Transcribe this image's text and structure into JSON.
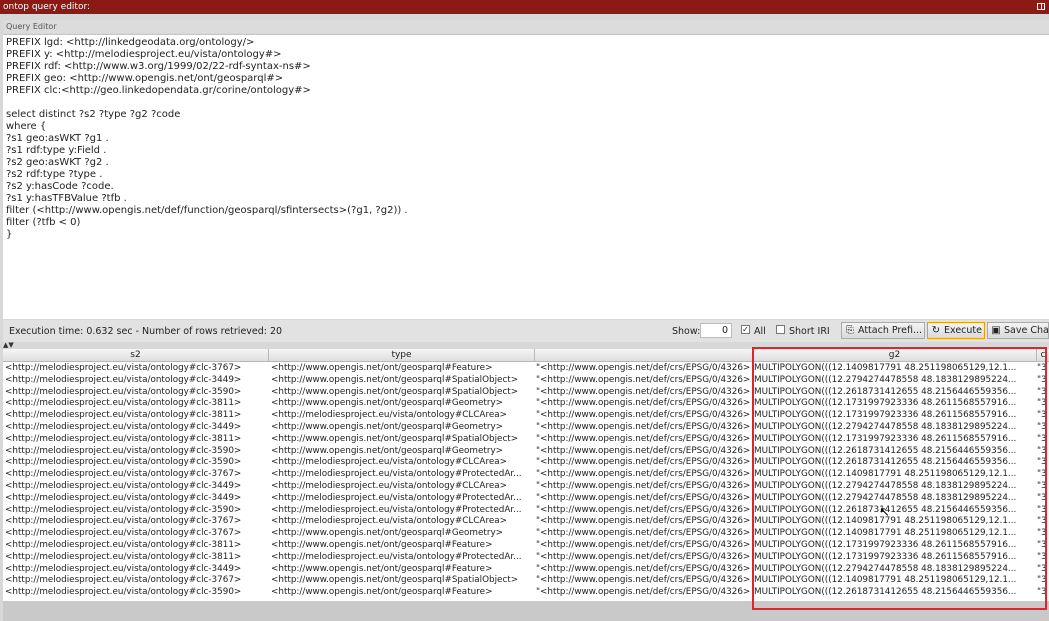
{
  "window": {
    "title": "ontop query editor:"
  },
  "panel": {
    "title": "Query Editor"
  },
  "editor": {
    "lines": [
      "PREFIX lgd: <http://linkedgeodata.org/ontology/>",
      "PREFIX y: <http://melodiesproject.eu/vista/ontology#>",
      "PREFIX rdf: <http://www.w3.org/1999/02/22-rdf-syntax-ns#>",
      "PREFIX geo: <http://www.opengis.net/ont/geosparql#>",
      "PREFIX clc:<http://geo.linkedopendata.gr/corine/ontology#>",
      "",
      "select distinct ?s2 ?type ?g2 ?code",
      "where {",
      "?s1 geo:asWKT ?g1 .",
      "?s1 rdf:type y:Field .",
      "?s2 geo:asWKT ?g2 .",
      "?s2 rdf:type ?type .",
      "?s2 y:hasCode ?code.",
      "?s1 y:hasTFBValue ?tfb .",
      "filter (<http://www.opengis.net/def/function/geosparql/sfintersects>(?g1, ?g2)) .",
      "filter (?tfb < 0)",
      "}"
    ]
  },
  "toolbar": {
    "execution_text": "Execution time: 0.632 sec - Number of rows retrieved: 20",
    "show_label": "Show:",
    "show_value": "0",
    "all_label": "All",
    "all_checked": true,
    "short_iri_label": "Short IRI",
    "short_iri_checked": false,
    "attach_prefix_label": "Attach Prefi...",
    "execute_label": "Execute",
    "save_label": "Save Cha"
  },
  "sort_indicator": "▲▼",
  "table": {
    "columns": [
      "s2",
      "type",
      "",
      "g2",
      "c"
    ],
    "rows": [
      [
        "<http://melodiesproject.eu/vista/ontology#clc-3767>",
        "<http://www.opengis.net/ont/geosparql#Feature>",
        "\"<http://www.opengis.net/def/crs/EPSG/0/4326>",
        "MULTIPOLYGON(((12.1409817791 48.251198065129,12.1...",
        "\"3"
      ],
      [
        "<http://melodiesproject.eu/vista/ontology#clc-3449>",
        "<http://www.opengis.net/ont/geosparql#SpatialObject>",
        "\"<http://www.opengis.net/def/crs/EPSG/0/4326>",
        "MULTIPOLYGON(((12.2794274478558 48.1838129895224...",
        "\"3"
      ],
      [
        "<http://melodiesproject.eu/vista/ontology#clc-3590>",
        "<http://www.opengis.net/ont/geosparql#SpatialObject>",
        "\"<http://www.opengis.net/def/crs/EPSG/0/4326>",
        "MULTIPOLYGON(((12.2618731412655 48.2156446559356...",
        "\"3"
      ],
      [
        "<http://melodiesproject.eu/vista/ontology#clc-3811>",
        "<http://www.opengis.net/ont/geosparql#Geometry>",
        "\"<http://www.opengis.net/def/crs/EPSG/0/4326>",
        "MULTIPOLYGON(((12.1731997923336 48.2611568557916...",
        "\"3"
      ],
      [
        "<http://melodiesproject.eu/vista/ontology#clc-3811>",
        "<http://melodiesproject.eu/vista/ontology#CLCArea>",
        "\"<http://www.opengis.net/def/crs/EPSG/0/4326>",
        "MULTIPOLYGON(((12.1731997923336 48.2611568557916...",
        "\"3"
      ],
      [
        "<http://melodiesproject.eu/vista/ontology#clc-3449>",
        "<http://www.opengis.net/ont/geosparql#Geometry>",
        "\"<http://www.opengis.net/def/crs/EPSG/0/4326>",
        "MULTIPOLYGON(((12.2794274478558 48.1838129895224...",
        "\"3"
      ],
      [
        "<http://melodiesproject.eu/vista/ontology#clc-3811>",
        "<http://www.opengis.net/ont/geosparql#SpatialObject>",
        "\"<http://www.opengis.net/def/crs/EPSG/0/4326>",
        "MULTIPOLYGON(((12.1731997923336 48.2611568557916...",
        "\"3"
      ],
      [
        "<http://melodiesproject.eu/vista/ontology#clc-3590>",
        "<http://www.opengis.net/ont/geosparql#Geometry>",
        "\"<http://www.opengis.net/def/crs/EPSG/0/4326>",
        "MULTIPOLYGON(((12.2618731412655 48.2156446559356...",
        "\"3"
      ],
      [
        "<http://melodiesproject.eu/vista/ontology#clc-3590>",
        "<http://melodiesproject.eu/vista/ontology#CLCArea>",
        "\"<http://www.opengis.net/def/crs/EPSG/0/4326>",
        "MULTIPOLYGON(((12.2618731412655 48.2156446559356...",
        "\"3"
      ],
      [
        "<http://melodiesproject.eu/vista/ontology#clc-3767>",
        "<http://melodiesproject.eu/vista/ontology#ProtectedAr...",
        "\"<http://www.opengis.net/def/crs/EPSG/0/4326>",
        "MULTIPOLYGON(((12.1409817791 48.251198065129,12.1...",
        "\"3"
      ],
      [
        "<http://melodiesproject.eu/vista/ontology#clc-3449>",
        "<http://melodiesproject.eu/vista/ontology#CLCArea>",
        "\"<http://www.opengis.net/def/crs/EPSG/0/4326>",
        "MULTIPOLYGON(((12.2794274478558 48.1838129895224...",
        "\"3"
      ],
      [
        "<http://melodiesproject.eu/vista/ontology#clc-3449>",
        "<http://melodiesproject.eu/vista/ontology#ProtectedAr...",
        "\"<http://www.opengis.net/def/crs/EPSG/0/4326>",
        "MULTIPOLYGON(((12.2794274478558 48.1838129895224...",
        "\"3"
      ],
      [
        "<http://melodiesproject.eu/vista/ontology#clc-3590>",
        "<http://melodiesproject.eu/vista/ontology#ProtectedAr...",
        "\"<http://www.opengis.net/def/crs/EPSG/0/4326>",
        "MULTIPOLYGON(((12.2618731412655 48.2156446559356...",
        "\"3"
      ],
      [
        "<http://melodiesproject.eu/vista/ontology#clc-3767>",
        "<http://melodiesproject.eu/vista/ontology#CLCArea>",
        "\"<http://www.opengis.net/def/crs/EPSG/0/4326>",
        "MULTIPOLYGON(((12.1409817791 48.251198065129,12.1...",
        "\"3"
      ],
      [
        "<http://melodiesproject.eu/vista/ontology#clc-3767>",
        "<http://www.opengis.net/ont/geosparql#Geometry>",
        "\"<http://www.opengis.net/def/crs/EPSG/0/4326>",
        "MULTIPOLYGON(((12.1409817791 48.251198065129,12.1...",
        "\"3"
      ],
      [
        "<http://melodiesproject.eu/vista/ontology#clc-3811>",
        "<http://www.opengis.net/ont/geosparql#Feature>",
        "\"<http://www.opengis.net/def/crs/EPSG/0/4326>",
        "MULTIPOLYGON(((12.1731997923336 48.2611568557916...",
        "\"3"
      ],
      [
        "<http://melodiesproject.eu/vista/ontology#clc-3811>",
        "<http://melodiesproject.eu/vista/ontology#ProtectedAr...",
        "\"<http://www.opengis.net/def/crs/EPSG/0/4326>",
        "MULTIPOLYGON(((12.1731997923336 48.2611568557916...",
        "\"3"
      ],
      [
        "<http://melodiesproject.eu/vista/ontology#clc-3449>",
        "<http://www.opengis.net/ont/geosparql#Feature>",
        "\"<http://www.opengis.net/def/crs/EPSG/0/4326>",
        "MULTIPOLYGON(((12.2794274478558 48.1838129895224...",
        "\"3"
      ],
      [
        "<http://melodiesproject.eu/vista/ontology#clc-3767>",
        "<http://www.opengis.net/ont/geosparql#SpatialObject>",
        "\"<http://www.opengis.net/def/crs/EPSG/0/4326>",
        "MULTIPOLYGON(((12.1409817791 48.251198065129,12.1...",
        "\"3"
      ],
      [
        "<http://melodiesproject.eu/vista/ontology#clc-3590>",
        "<http://www.opengis.net/ont/geosparql#Feature>",
        "\"<http://www.opengis.net/def/crs/EPSG/0/4326>",
        "MULTIPOLYGON(((12.2618731412655 48.2156446559356...",
        "\"3"
      ]
    ]
  },
  "colors": {
    "titlebar": "#8b1a14",
    "highlight": "#e0242c"
  },
  "icons": {
    "attach": "paperclip-icon",
    "execute": "execute-icon",
    "save": "save-icon"
  }
}
